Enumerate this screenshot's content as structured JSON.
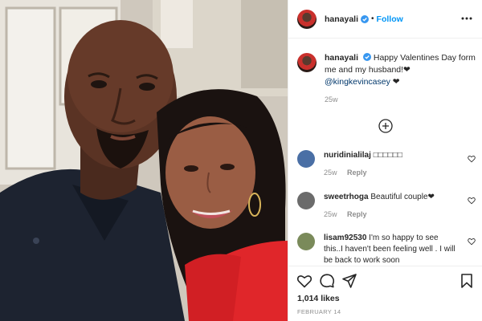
{
  "post": {
    "author": "hanayali",
    "verified": true,
    "follow_label": "Follow",
    "separator": "•",
    "caption_text": "Happy Valentines Day form me and my husband!❤",
    "caption_mention": "@kingkevincasey",
    "caption_suffix": " ❤",
    "caption_time": "25w",
    "likes": "1,014 likes",
    "date": "FEBRUARY 14"
  },
  "comments": [
    {
      "user": "nuridinialilaj",
      "text": "□□□□□□",
      "time": "25w",
      "reply_label": "Reply",
      "avatar_color": "#4a6fa5"
    },
    {
      "user": "sweetrhoga",
      "text": "Beautiful couple❤",
      "time": "25w",
      "reply_label": "Reply",
      "avatar_color": "#6b6b6b"
    },
    {
      "user": "lisam92530",
      "text": "I'm so happy to see this..I haven't been feeling well . I will be back to work soon",
      "time": "",
      "reply_label": "",
      "avatar_color": "#7a8a5a"
    }
  ],
  "icons": {
    "more": "more-options-icon",
    "verified": "verified-badge-icon",
    "load_more": "plus-circle-icon",
    "like": "heart-icon",
    "comment": "comment-icon",
    "share": "paper-plane-icon",
    "save": "bookmark-icon",
    "comment_like": "small-heart-icon"
  },
  "colors": {
    "link": "#0095f6",
    "mention": "#00376b",
    "muted": "#8e8e8e",
    "verified": "#3897f0"
  }
}
